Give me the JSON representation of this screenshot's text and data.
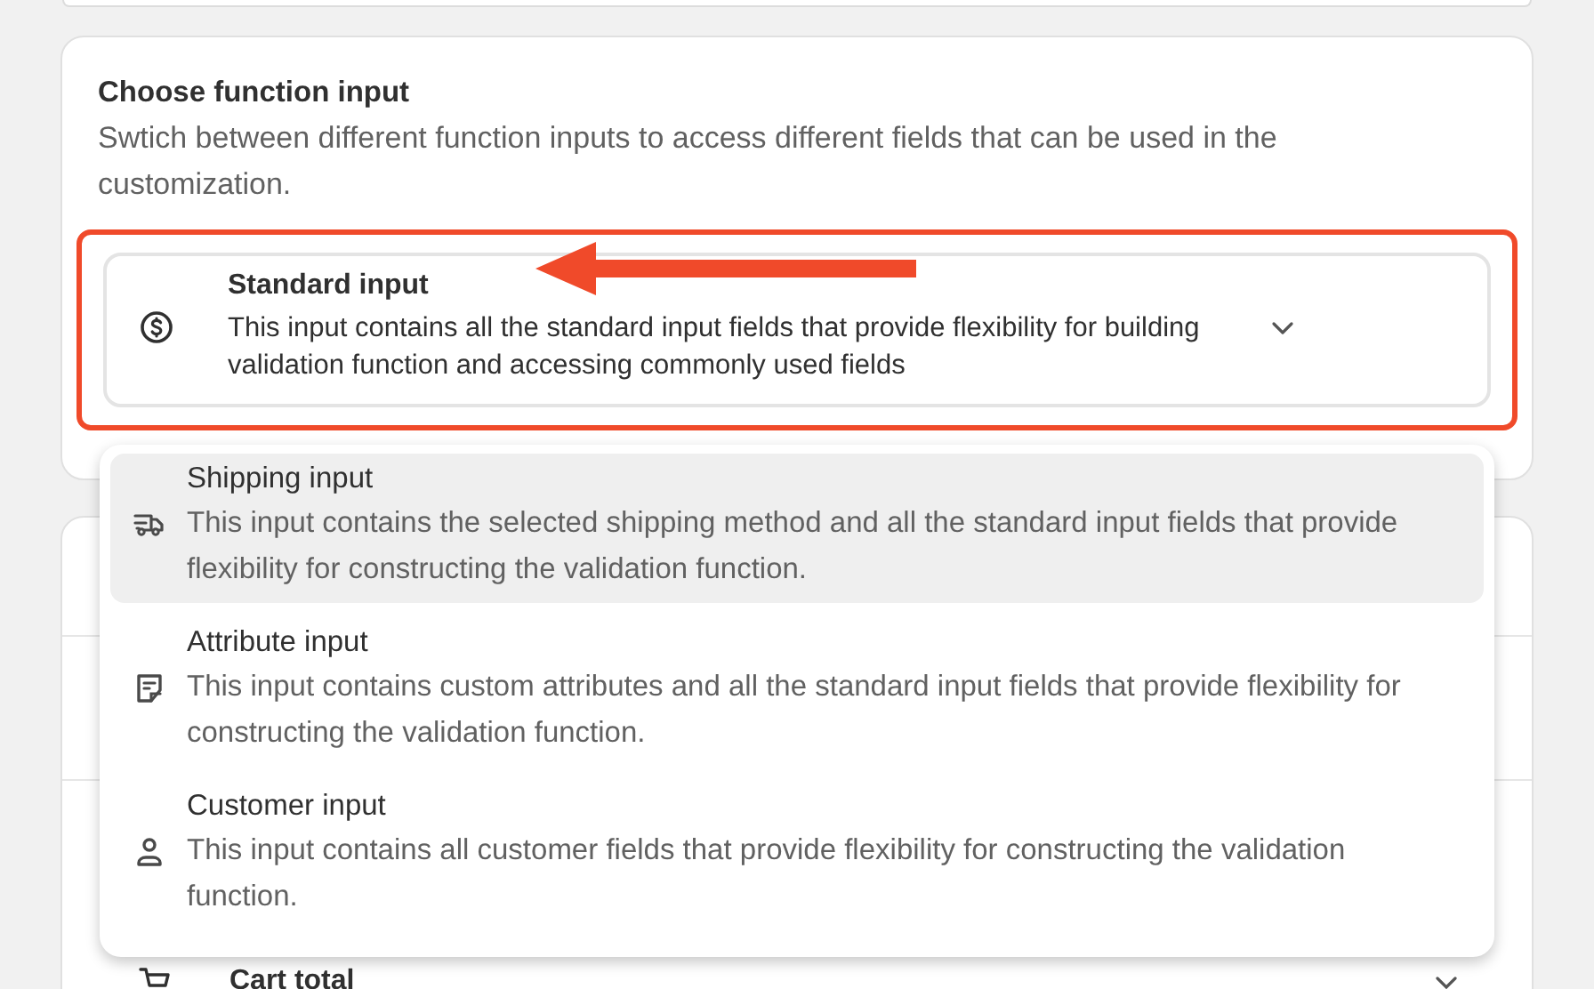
{
  "chooser": {
    "title": "Choose function input",
    "description": "Swtich between different function inputs to access different fields that can be used in the customization.",
    "field": {
      "title": "Standard input",
      "description": "This input contains all the standard input fields that provide flexibility for building validation function and accessing commonly used fields",
      "expanded": true
    }
  },
  "options": [
    {
      "kind": "shipping",
      "title": "Shipping input",
      "description": "This input contains the selected shipping method and all the standard input fields that provide flexibility for constructing the validation function.",
      "selected": true
    },
    {
      "kind": "attribute",
      "title": "Attribute input",
      "description": "This input contains custom attributes and all the standard input fields that provide flexibility for constructing the validation function.",
      "selected": false
    },
    {
      "kind": "customer",
      "title": "Customer input",
      "description": "This input contains all customer fields that provide flexibility for constructing the validation function.",
      "selected": false
    }
  ],
  "behind_card": {
    "rows": [
      {
        "label": "Cart total"
      }
    ]
  }
}
